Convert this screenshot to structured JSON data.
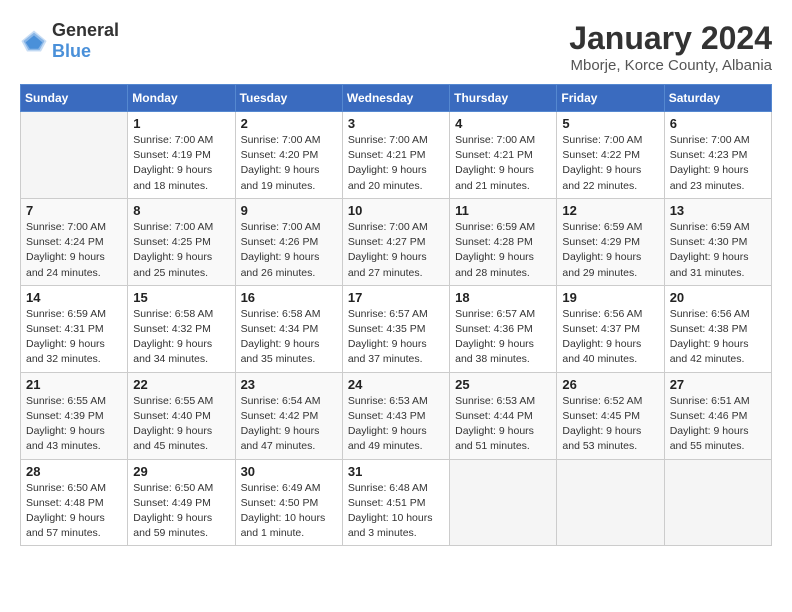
{
  "header": {
    "logo_general": "General",
    "logo_blue": "Blue",
    "main_title": "January 2024",
    "subtitle": "Mborje, Korce County, Albania"
  },
  "days_of_week": [
    "Sunday",
    "Monday",
    "Tuesday",
    "Wednesday",
    "Thursday",
    "Friday",
    "Saturday"
  ],
  "weeks": [
    [
      {
        "day": "",
        "info": ""
      },
      {
        "day": "1",
        "info": "Sunrise: 7:00 AM\nSunset: 4:19 PM\nDaylight: 9 hours\nand 18 minutes."
      },
      {
        "day": "2",
        "info": "Sunrise: 7:00 AM\nSunset: 4:20 PM\nDaylight: 9 hours\nand 19 minutes."
      },
      {
        "day": "3",
        "info": "Sunrise: 7:00 AM\nSunset: 4:21 PM\nDaylight: 9 hours\nand 20 minutes."
      },
      {
        "day": "4",
        "info": "Sunrise: 7:00 AM\nSunset: 4:21 PM\nDaylight: 9 hours\nand 21 minutes."
      },
      {
        "day": "5",
        "info": "Sunrise: 7:00 AM\nSunset: 4:22 PM\nDaylight: 9 hours\nand 22 minutes."
      },
      {
        "day": "6",
        "info": "Sunrise: 7:00 AM\nSunset: 4:23 PM\nDaylight: 9 hours\nand 23 minutes."
      }
    ],
    [
      {
        "day": "7",
        "info": "Sunrise: 7:00 AM\nSunset: 4:24 PM\nDaylight: 9 hours\nand 24 minutes."
      },
      {
        "day": "8",
        "info": "Sunrise: 7:00 AM\nSunset: 4:25 PM\nDaylight: 9 hours\nand 25 minutes."
      },
      {
        "day": "9",
        "info": "Sunrise: 7:00 AM\nSunset: 4:26 PM\nDaylight: 9 hours\nand 26 minutes."
      },
      {
        "day": "10",
        "info": "Sunrise: 7:00 AM\nSunset: 4:27 PM\nDaylight: 9 hours\nand 27 minutes."
      },
      {
        "day": "11",
        "info": "Sunrise: 6:59 AM\nSunset: 4:28 PM\nDaylight: 9 hours\nand 28 minutes."
      },
      {
        "day": "12",
        "info": "Sunrise: 6:59 AM\nSunset: 4:29 PM\nDaylight: 9 hours\nand 29 minutes."
      },
      {
        "day": "13",
        "info": "Sunrise: 6:59 AM\nSunset: 4:30 PM\nDaylight: 9 hours\nand 31 minutes."
      }
    ],
    [
      {
        "day": "14",
        "info": "Sunrise: 6:59 AM\nSunset: 4:31 PM\nDaylight: 9 hours\nand 32 minutes."
      },
      {
        "day": "15",
        "info": "Sunrise: 6:58 AM\nSunset: 4:32 PM\nDaylight: 9 hours\nand 34 minutes."
      },
      {
        "day": "16",
        "info": "Sunrise: 6:58 AM\nSunset: 4:34 PM\nDaylight: 9 hours\nand 35 minutes."
      },
      {
        "day": "17",
        "info": "Sunrise: 6:57 AM\nSunset: 4:35 PM\nDaylight: 9 hours\nand 37 minutes."
      },
      {
        "day": "18",
        "info": "Sunrise: 6:57 AM\nSunset: 4:36 PM\nDaylight: 9 hours\nand 38 minutes."
      },
      {
        "day": "19",
        "info": "Sunrise: 6:56 AM\nSunset: 4:37 PM\nDaylight: 9 hours\nand 40 minutes."
      },
      {
        "day": "20",
        "info": "Sunrise: 6:56 AM\nSunset: 4:38 PM\nDaylight: 9 hours\nand 42 minutes."
      }
    ],
    [
      {
        "day": "21",
        "info": "Sunrise: 6:55 AM\nSunset: 4:39 PM\nDaylight: 9 hours\nand 43 minutes."
      },
      {
        "day": "22",
        "info": "Sunrise: 6:55 AM\nSunset: 4:40 PM\nDaylight: 9 hours\nand 45 minutes."
      },
      {
        "day": "23",
        "info": "Sunrise: 6:54 AM\nSunset: 4:42 PM\nDaylight: 9 hours\nand 47 minutes."
      },
      {
        "day": "24",
        "info": "Sunrise: 6:53 AM\nSunset: 4:43 PM\nDaylight: 9 hours\nand 49 minutes."
      },
      {
        "day": "25",
        "info": "Sunrise: 6:53 AM\nSunset: 4:44 PM\nDaylight: 9 hours\nand 51 minutes."
      },
      {
        "day": "26",
        "info": "Sunrise: 6:52 AM\nSunset: 4:45 PM\nDaylight: 9 hours\nand 53 minutes."
      },
      {
        "day": "27",
        "info": "Sunrise: 6:51 AM\nSunset: 4:46 PM\nDaylight: 9 hours\nand 55 minutes."
      }
    ],
    [
      {
        "day": "28",
        "info": "Sunrise: 6:50 AM\nSunset: 4:48 PM\nDaylight: 9 hours\nand 57 minutes."
      },
      {
        "day": "29",
        "info": "Sunrise: 6:50 AM\nSunset: 4:49 PM\nDaylight: 9 hours\nand 59 minutes."
      },
      {
        "day": "30",
        "info": "Sunrise: 6:49 AM\nSunset: 4:50 PM\nDaylight: 10 hours\nand 1 minute."
      },
      {
        "day": "31",
        "info": "Sunrise: 6:48 AM\nSunset: 4:51 PM\nDaylight: 10 hours\nand 3 minutes."
      },
      {
        "day": "",
        "info": ""
      },
      {
        "day": "",
        "info": ""
      },
      {
        "day": "",
        "info": ""
      }
    ]
  ]
}
